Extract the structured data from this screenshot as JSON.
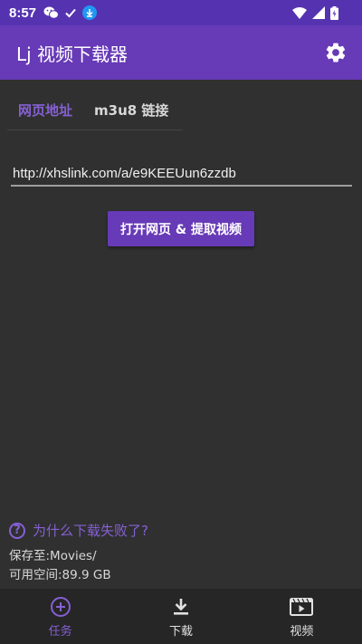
{
  "status_bar": {
    "time": "8:57",
    "left_icons": [
      "wechat-icon",
      "check-icon",
      "download-badge-icon"
    ],
    "right_icons": [
      "wifi-icon",
      "signal-icon",
      "battery-icon"
    ]
  },
  "app_bar": {
    "title": "Lj 视频下载器",
    "settings_icon": "gear-icon",
    "color": "#673ab7"
  },
  "tabs": [
    {
      "label": "网页地址",
      "active": true
    },
    {
      "label": "m3u8 链接",
      "active": false
    }
  ],
  "url_input": {
    "value": "http://xhslink.com/a/e9KEEUun6zzdb"
  },
  "primary_button": {
    "label": "打开网页 & 提取视频"
  },
  "help": {
    "label": "为什么下载失败了?",
    "icon": "help-circle-icon"
  },
  "info": {
    "save_to": "保存至:Movies/",
    "free_space": "可用空间:89.9 GB"
  },
  "bottom_nav": [
    {
      "label": "任务",
      "icon": "plus-circle-icon",
      "active": true
    },
    {
      "label": "下载",
      "icon": "download-icon",
      "active": false
    },
    {
      "label": "视频",
      "icon": "film-icon",
      "active": false
    }
  ],
  "colors": {
    "accent": "#8560d4",
    "primary": "#673ab7",
    "status_bar": "#5533b0",
    "background": "#303030",
    "nav_background": "#262626"
  }
}
